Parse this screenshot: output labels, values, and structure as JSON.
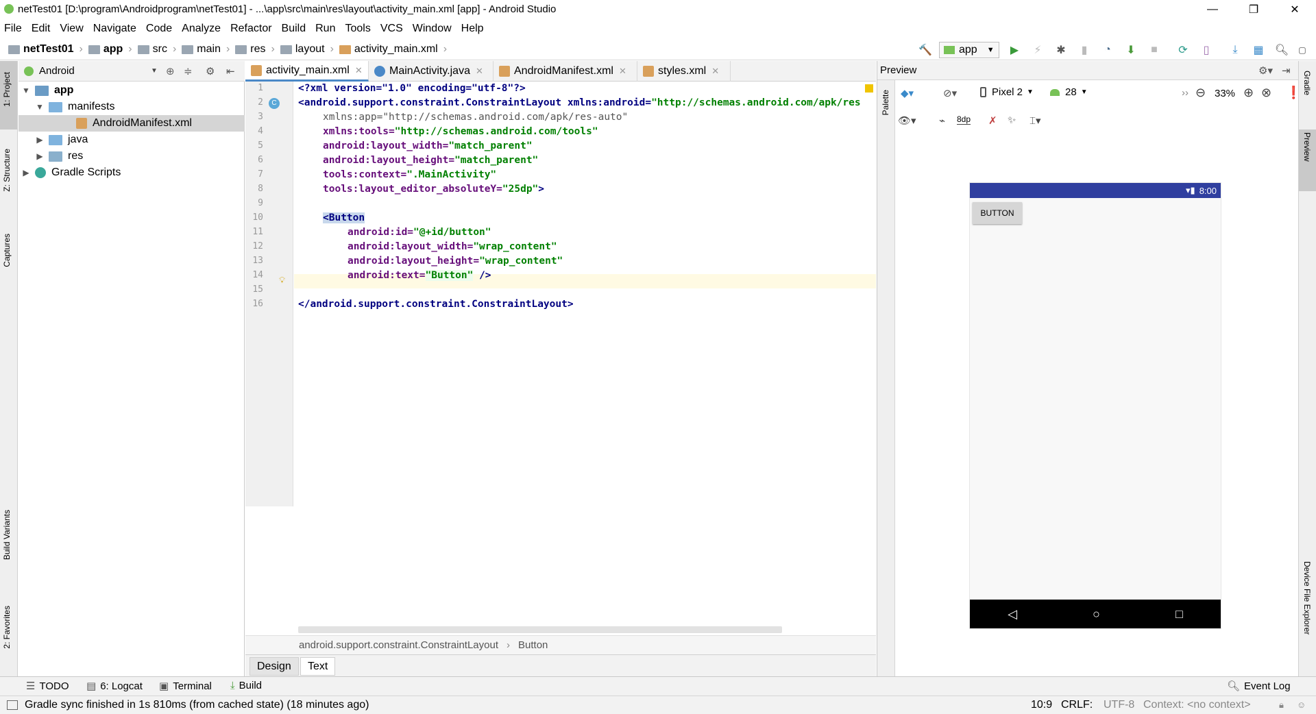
{
  "window": {
    "title": "netTest01 [D:\\program\\Androidprogram\\netTest01] - ...\\app\\src\\main\\res\\layout\\activity_main.xml [app] - Android Studio",
    "minimize": "—",
    "restore": "❐",
    "close": "✕"
  },
  "menu": [
    "File",
    "Edit",
    "View",
    "Navigate",
    "Code",
    "Analyze",
    "Refactor",
    "Build",
    "Run",
    "Tools",
    "VCS",
    "Window",
    "Help"
  ],
  "breadcrumbs": [
    "netTest01",
    "app",
    "src",
    "main",
    "res",
    "layout",
    "activity_main.xml"
  ],
  "run_config": "app",
  "left_strip": {
    "project": "1: Project",
    "structure": "Z: Structure",
    "captures": "Captures",
    "build_variants": "Build Variants",
    "favorites": "2: Favorites"
  },
  "right_strip": {
    "gradle": "Gradle",
    "preview": "Preview",
    "device_file_explorer": "Device File Explorer"
  },
  "project_panel": {
    "view_mode": "Android",
    "tree": [
      {
        "label": "app",
        "level": 0,
        "expanded": true,
        "bold": true
      },
      {
        "label": "manifests",
        "level": 1,
        "expanded": true
      },
      {
        "label": "AndroidManifest.xml",
        "level": 2,
        "selected": true
      },
      {
        "label": "java",
        "level": 1,
        "expanded": false
      },
      {
        "label": "res",
        "level": 1,
        "expanded": false
      },
      {
        "label": "Gradle Scripts",
        "level": 0,
        "expanded": false
      }
    ]
  },
  "editor_tabs": [
    {
      "label": "activity_main.xml",
      "active": true
    },
    {
      "label": "MainActivity.java",
      "active": false
    },
    {
      "label": "AndroidManifest.xml",
      "active": false
    },
    {
      "label": "styles.xml",
      "active": false
    }
  ],
  "code_lines": [
    "1",
    "2",
    "3",
    "4",
    "5",
    "6",
    "7",
    "8",
    "9",
    "10",
    "11",
    "12",
    "13",
    "14",
    "15",
    "16"
  ],
  "code": {
    "l1": "<?xml version=\"1.0\" encoding=\"utf-8\"?>",
    "l2_tag": "<android.support.constraint.ConstraintLayout",
    "l2_attr": " xmlns:android=",
    "l2_val": "\"http://schemas.android.com/apk/res",
    "l3_attr": "xmlns:app=",
    "l3_val": "\"http://schemas.android.com/apk/res-auto\"",
    "l4_attr": "xmlns:tools=",
    "l4_val": "\"http://schemas.android.com/tools\"",
    "l5_attr": "android:layout_width=",
    "l5_val": "\"match_parent\"",
    "l6_attr": "android:layout_height=",
    "l6_val": "\"match_parent\"",
    "l7_attr": "tools:context=",
    "l7_val": "\".MainActivity\"",
    "l8_attr": "tools:layout_editor_absoluteY=",
    "l8_val": "\"25dp\"",
    "l8_end": ">",
    "l10_tag": "<Button",
    "l11_attr": "android:id=",
    "l11_val": "\"@+id/button\"",
    "l12_attr": "android:layout_width=",
    "l12_val": "\"wrap_content\"",
    "l13_attr": "android:layout_height=",
    "l13_val": "\"wrap_content\"",
    "l14_attr": "android:text=",
    "l14_val": "\"Button\"",
    "l14_end": " />",
    "l16": "</android.support.constraint.ConstraintLayout>"
  },
  "editor_breadcrumb": [
    "android.support.constraint.ConstraintLayout",
    "Button"
  ],
  "mode_tabs": [
    {
      "label": "Design",
      "active": false
    },
    {
      "label": "Text",
      "active": true
    }
  ],
  "preview": {
    "title": "Preview",
    "palette": "Palette",
    "device": "Pixel 2",
    "api": "28",
    "zoom": "33%",
    "margin": "8dp",
    "phone_time": "8:00",
    "phone_button": "BUTTON"
  },
  "tool_windows": {
    "todo": "TODO",
    "logcat": "6: Logcat",
    "terminal": "Terminal",
    "build": "Build",
    "event_log": "Event Log"
  },
  "status": {
    "message": "Gradle sync finished in 1s 810ms (from cached state) (18 minutes ago)",
    "position": "10:9",
    "line_sep": "CRLF:",
    "encoding": "UTF-8",
    "context": "Context: <no context>"
  },
  "colors": {
    "accent": "#4a88c7",
    "run_green": "#3a9b3a",
    "phone_status": "#303f9f"
  }
}
